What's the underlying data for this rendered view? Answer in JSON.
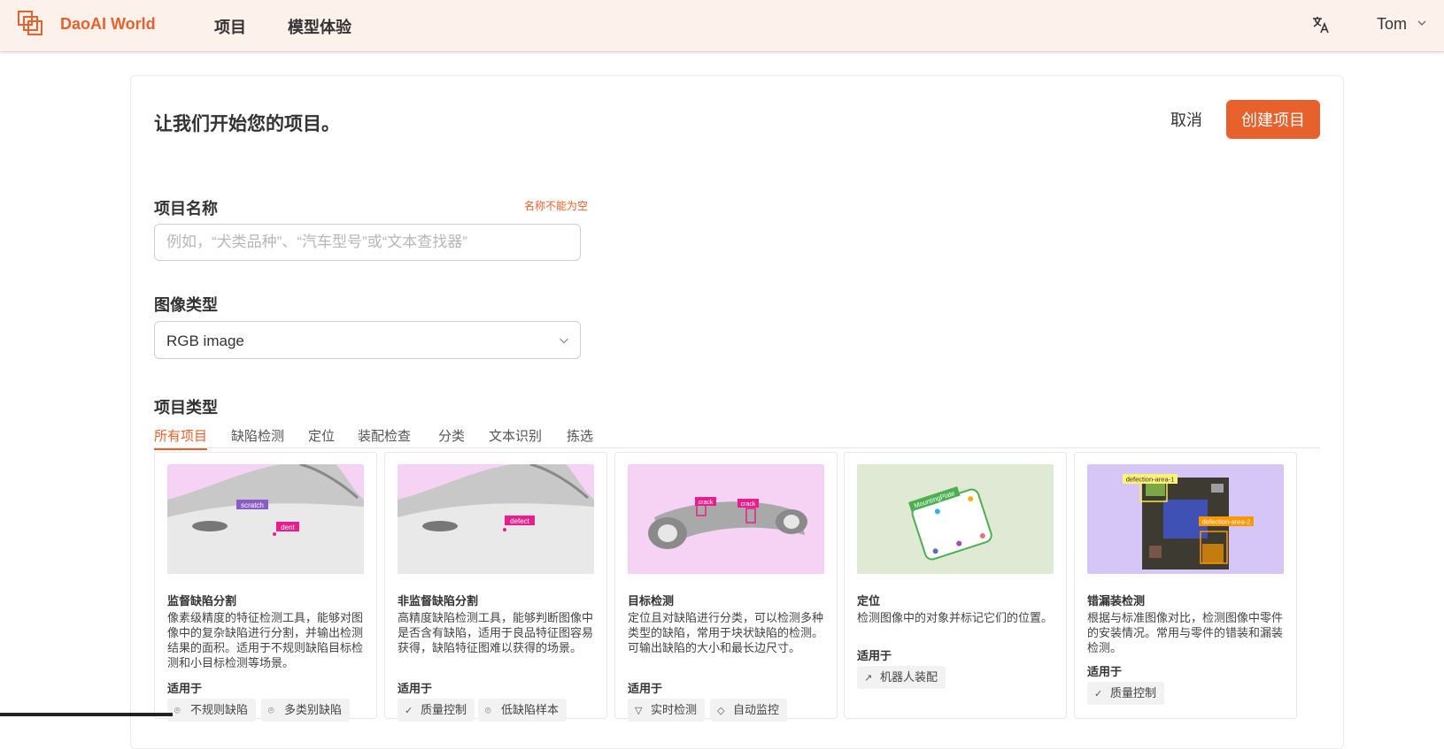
{
  "app": {
    "brand": "DaoAI World",
    "nav": [
      "项目",
      "模型体验"
    ],
    "user": "Tom"
  },
  "page": {
    "title": "让我们开始您的项目。",
    "cancel_label": "取消",
    "create_label": "创建项目"
  },
  "form": {
    "name_label": "项目名称",
    "name_error": "名称不能为空",
    "name_placeholder": "例如，“犬类品种”、“汽车型号”或“文本查找器”",
    "image_type_label": "图像类型",
    "image_type_value": "RGB image",
    "project_type_label": "项目类型"
  },
  "tabs": [
    "所有项目",
    "缺陷检测",
    "定位",
    "装配检查",
    "分类",
    "文本识别",
    "拣选"
  ],
  "active_tab": "所有项目",
  "cards": [
    {
      "title": "监督缺陷分割",
      "desc": "像素级精度的特征检测工具，能够对图像中的复杂缺陷进行分割，并输出检测结果的面积。适用于不规则缺陷目标检测和小目标检测等场景。",
      "applies_label": "适用于",
      "tags": [
        {
          "icon": "scan-icon",
          "label": "不规则缺陷"
        },
        {
          "icon": "scan-icon",
          "label": "多类别缺陷"
        }
      ],
      "thumb_labels": [
        "scratch",
        "dent"
      ]
    },
    {
      "title": "非监督缺陷分割",
      "desc": "高精度缺陷检测工具，能够判断图像中是否含有缺陷，适用于良品特征图容易获得，缺陷特征图难以获得的场景。",
      "applies_label": "适用于",
      "tags": [
        {
          "icon": "check-icon",
          "label": "质量控制"
        },
        {
          "icon": "scan-icon",
          "label": "低缺陷样本"
        }
      ],
      "thumb_labels": [
        "defect"
      ]
    },
    {
      "title": "目标检测",
      "desc": "定位且对缺陷进行分类，可以检测多种类型的缺陷，常用于块状缺陷的检测。可输出缺陷的大小和最长边尺寸。",
      "applies_label": "适用于",
      "tags": [
        {
          "icon": "filter-icon",
          "label": "实时检测"
        },
        {
          "icon": "tag-icon",
          "label": "自动监控"
        }
      ],
      "thumb_labels": [
        "crack",
        "crack"
      ]
    },
    {
      "title": "定位",
      "desc": "检测图像中的对象并标记它们的位置。",
      "applies_label": "适用于",
      "tags": [
        {
          "icon": "robot-arm-icon",
          "label": "机器人装配"
        }
      ],
      "thumb_labels": [
        "MountingPlate"
      ]
    },
    {
      "title": "错漏装检测",
      "desc": "根据与标准图像对比，检测图像中零件的安装情况。常用与零件的错装和漏装检测。",
      "applies_label": "适用于",
      "tags": [
        {
          "icon": "check-icon",
          "label": "质量控制"
        }
      ],
      "thumb_labels": [
        "defection-area-1",
        "defection-area-2"
      ]
    }
  ],
  "colors": {
    "accent": "#e8612c",
    "topbar_bg": "#fdf1ec",
    "thumb_pink": "#f6d3f4",
    "thumb_green": "#dfe9d3",
    "thumb_purple": "#d5c6f7"
  }
}
